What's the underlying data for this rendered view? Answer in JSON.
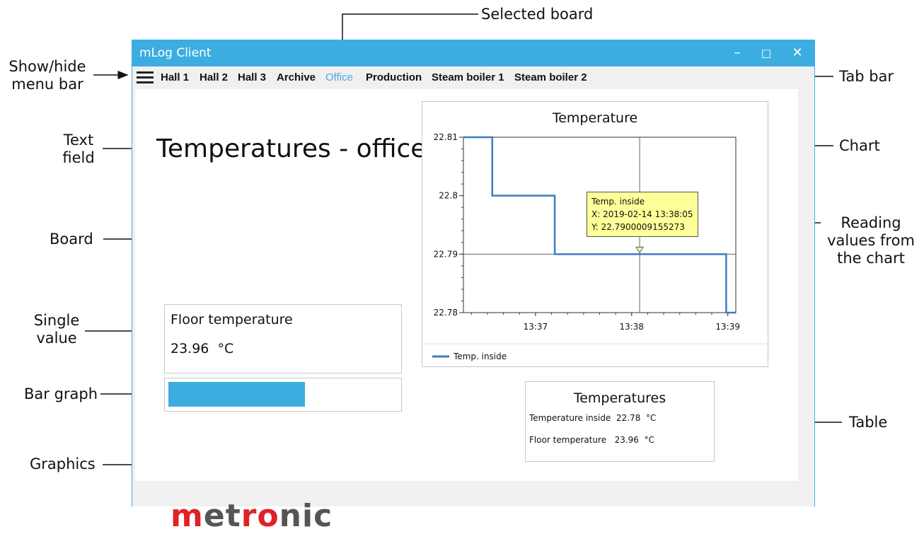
{
  "annotations": {
    "selected_board": "Selected board",
    "show_hide_menu": [
      "Show/hide",
      "menu bar"
    ],
    "tab_bar": "Tab bar",
    "text_field": [
      "Text",
      "field"
    ],
    "chart": "Chart",
    "board": "Board",
    "reading_values": [
      "Reading",
      "values from",
      "the chart"
    ],
    "single_value": [
      "Single",
      "value"
    ],
    "bar_graph": "Bar graph",
    "table": "Table",
    "graphics": "Graphics"
  },
  "window": {
    "title": "mLog Client",
    "minimize": "–",
    "maximize": "□",
    "close": "✕"
  },
  "tabs": [
    {
      "label": "Hall 1",
      "selected": false
    },
    {
      "label": "Hall 2",
      "selected": false
    },
    {
      "label": "Hall 3",
      "selected": false
    },
    {
      "label": "Archive",
      "selected": false
    },
    {
      "label": "Office",
      "selected": true
    },
    {
      "label": "Production",
      "selected": false
    },
    {
      "label": "Steam boiler 1",
      "selected": false
    },
    {
      "label": "Steam boiler 2",
      "selected": false
    }
  ],
  "board": {
    "text_field": "Temperatures - office",
    "single_value": {
      "label": "Floor temperature",
      "value": "23.96",
      "unit": "°C"
    },
    "bar_graph": {
      "fraction": 0.6
    },
    "logo": {
      "text": "metronic"
    }
  },
  "chart_data": {
    "type": "line",
    "title": "Temperature",
    "xlabel": "",
    "ylabel": "",
    "x_ticks": [
      "13:37",
      "13:38",
      "13:39"
    ],
    "y_ticks": [
      "22.78",
      "22.79",
      "22.8",
      "22.81"
    ],
    "ylim": [
      22.78,
      22.81
    ],
    "xlim": [
      "13:36:15",
      "13:39:05"
    ],
    "grid": false,
    "legend_position": "bottom-left",
    "series": [
      {
        "name": "Temp. inside",
        "color": "#3b7dc4",
        "points": [
          [
            "13:36:15",
            22.81
          ],
          [
            "13:36:33",
            22.81
          ],
          [
            "13:36:33",
            22.8
          ],
          [
            "13:37:12",
            22.8
          ],
          [
            "13:37:12",
            22.79
          ],
          [
            "13:38:59",
            22.79
          ],
          [
            "13:38:59",
            22.78
          ],
          [
            "13:39:05",
            22.78
          ]
        ]
      }
    ],
    "crosshair": {
      "x": "13:38:05",
      "y": 22.79
    },
    "tooltip": {
      "series": "Temp. inside",
      "x_text": "X: 2019-02-14 13:38:05",
      "y_text": "Y: 22.7900009155273"
    }
  },
  "table": {
    "title": "Temperatures",
    "rows": [
      {
        "label": "Temperature inside",
        "value": "22.78",
        "unit": "°C"
      },
      {
        "label": "Floor temperature",
        "value": "23.96",
        "unit": "°C"
      }
    ]
  }
}
